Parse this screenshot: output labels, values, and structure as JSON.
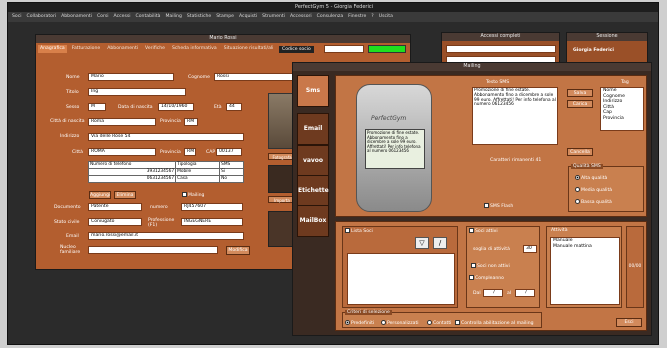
{
  "app": {
    "title": "PerfectGym 5 - Giorgia Federici",
    "menu": [
      "Soci",
      "Collaboratori",
      "Abbonamenti",
      "Corsi",
      "Accessi",
      "Contabilità",
      "Mailing",
      "Statistiche",
      "Stampe",
      "Acquisti",
      "Strumenti",
      "Accessori",
      "Consulenza",
      "Finestre",
      "?",
      "Uscita"
    ]
  },
  "socio": {
    "title": "Mario Rossi",
    "tabs": [
      "Anagrafica",
      "Fatturazione",
      "Abbonamenti",
      "Verifiche",
      "Scheda informativa",
      "Situazione risultati/ali"
    ],
    "codice_label": "Codice socio",
    "nome_label": "Nome",
    "nome": "Mario",
    "cognome_label": "Cognome",
    "cognome": "Rossi",
    "titolo_label": "Titolo",
    "titolo": "Ing",
    "sesso_label": "Sesso",
    "sesso": "M",
    "nascita_label": "Data di nascita",
    "nascita": "14/10/1960",
    "eta_label": "Età",
    "eta": "44",
    "citta_nascita_label": "Città di nascita",
    "citta_nascita": "Roma",
    "provincia_label": "Provincia",
    "prov_nascita": "RM",
    "indirizzo_label": "Indirizzo",
    "indirizzo": "Via delle Rose 54",
    "citta_label": "Città",
    "citta": "ROMA",
    "provincia2_label": "Provincia",
    "prov": "RM",
    "cap_label": "CAP",
    "cap": "00137",
    "phone_headers": [
      "Numero di telefono",
      "Tipologia",
      "SMS"
    ],
    "phones": [
      [
        "3931234567",
        "Mobile",
        "Si"
      ],
      [
        "0631234567",
        "Casa",
        "No"
      ]
    ],
    "aggiungi": "Aggiungi",
    "elimina": "Elimina",
    "mailing": "Mailing",
    "documento_label": "Documento",
    "documento": "Patente",
    "numero_label": "numero",
    "numero": "RJ457607",
    "stato_label": "Stato civile",
    "stato": "Coniugato",
    "professione_label": "Professione (F1)",
    "professione": "INGEGNERE",
    "email_label": "Email",
    "email": "mario.rossi@email.it",
    "nucleo_label": "Nucleo familiare",
    "modifica": "Modifica",
    "fotografa": "Fotografa",
    "importa": "Importa"
  },
  "accessi": {
    "title": "Accessi completi"
  },
  "sessione": {
    "title": "Sessione",
    "user": "Giorgia Federici"
  },
  "mailing": {
    "title": "Mailing",
    "side": [
      "Sms",
      "Email",
      "vavoo",
      "Etichette",
      "MailBox"
    ],
    "testo_label": "Testo SMS",
    "sms_text": "Promozione di fine estate. Abbonamento fino a dicembre a sole 99 euro. Affrettati! Per info telefona al numero 06123456",
    "phone_screen": "Promozione di fine estate. Abbonamento fino a dicembre a sole 99 euro. Affrettati! Per info telefona al numero 06123456",
    "brand": "PerfectGym",
    "salva": "Salva",
    "carica": "Carica",
    "cancella": "Cancella",
    "tag_label": "Tag",
    "tags": [
      "Nome",
      "Cognome",
      "Indirizzo",
      "Città",
      "Cap",
      "Provincia"
    ],
    "caratteri": "Caratteri rimanenti",
    "caratteri_val": "41",
    "sms_flash": "SMS Flash",
    "qualita_label": "Qualità SMS",
    "qualita": [
      "Alta qualità",
      "Media qualità",
      "Bassa qualità"
    ],
    "lista_soci": "Lista Soci",
    "soci_attivi": "Soci attivi",
    "soglia": "soglia di attività",
    "soglia_val": "30",
    "soci_non_attivi": "Soci non attivi",
    "compleanno": "Compleanno",
    "dal": "Dal",
    "al": "al",
    "slash": "/",
    "attivita": "Attività",
    "attivita_items": [
      "Manuale",
      "Manuale mattina"
    ],
    "count": "00/00",
    "criteri": "Criteri di selezione",
    "criteri_opts": [
      "Predefiniti",
      "Personalizzati",
      "Contatti"
    ],
    "controlla": "Controlla abilitazione al mailing",
    "esci": "Esci"
  }
}
